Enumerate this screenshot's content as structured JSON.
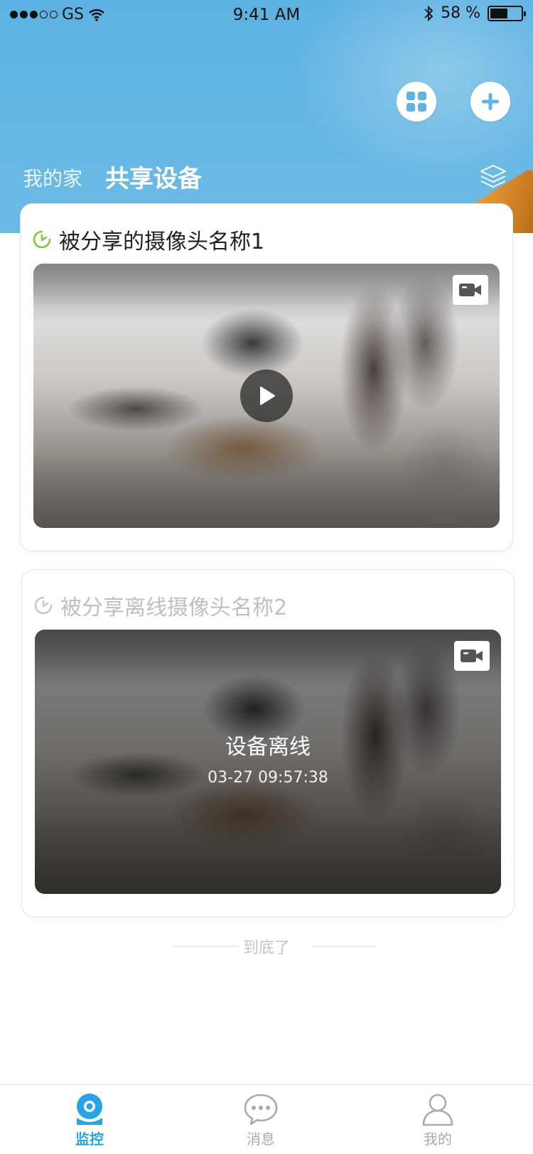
{
  "status_bar": {
    "carrier": "GS",
    "time": "9:41 AM",
    "battery": "58 %",
    "battery_level": 0.58
  },
  "header": {
    "tab_home": "我的家",
    "tab_shared": "共享设备",
    "icons": [
      "grid-icon",
      "plus-icon",
      "layers-icon"
    ]
  },
  "devices": [
    {
      "name": "被分享的摄像头名称1",
      "status": "online",
      "status_icon": "online-clock-icon"
    },
    {
      "name": "被分享离线摄像头名称2",
      "status": "offline",
      "status_icon": "offline-clock-icon",
      "offline_label": "设备离线",
      "offline_time": "03-27 09:57:38"
    }
  ],
  "end_text": "到底了",
  "tab_bar": {
    "monitor": "监控",
    "messages": "消息",
    "mine": "我的",
    "active": "monitor"
  },
  "colors": {
    "accent": "#26a4e8",
    "header": "#5cb2e2",
    "online_green": "#7ac943",
    "inactive": "#aaaaaa"
  }
}
